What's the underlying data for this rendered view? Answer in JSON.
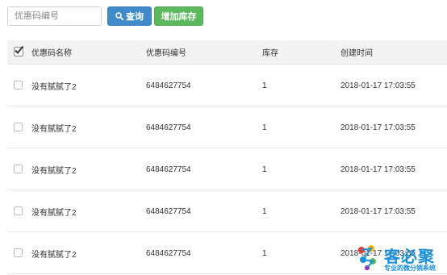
{
  "toolbar": {
    "search_placeholder": "优惠码编号",
    "query_label": "查询",
    "add_label": "增加库存"
  },
  "table": {
    "headers": {
      "name": "优惠码名称",
      "code": "优惠码编号",
      "stock": "库存",
      "created": "创建时间"
    },
    "rows": [
      {
        "name": "没有腻腻了2",
        "code": "6484627754",
        "stock": "1",
        "created": "2018-01-17 17:03:55"
      },
      {
        "name": "没有腻腻了2",
        "code": "6484627754",
        "stock": "1",
        "created": "2018-01-17 17:03:55"
      },
      {
        "name": "没有腻腻了2",
        "code": "6484627754",
        "stock": "1",
        "created": "2018-01-17 17:03:55"
      },
      {
        "name": "没有腻腻了2",
        "code": "6484627754",
        "stock": "1",
        "created": "2018-01-17 17:03:55"
      },
      {
        "name": "没有腻腻了2",
        "code": "6484627754",
        "stock": "1",
        "created": "2018-01-17 17:03:55"
      }
    ]
  },
  "watermark": {
    "title": "客必聚",
    "subtitle": "专业的微分销系统"
  },
  "colors": {
    "query_button": "#428bca",
    "add_button": "#5cb85c",
    "header_bg": "#f3f3f3",
    "watermark": "#1a8fd8"
  }
}
